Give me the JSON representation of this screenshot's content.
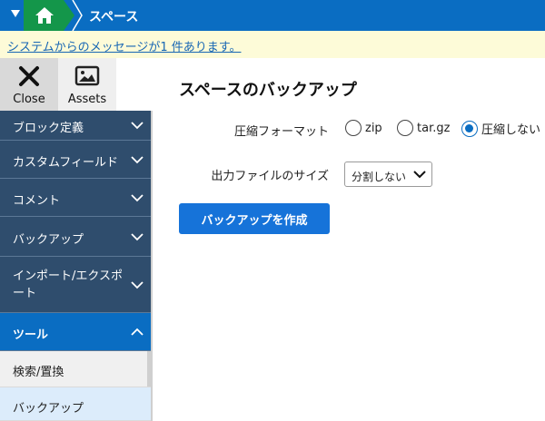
{
  "topbar": {
    "title": "スペース"
  },
  "message": {
    "text": "システムからのメッセージが1 件あります。"
  },
  "tools": {
    "close_label": "Close",
    "assets_label": "Assets"
  },
  "sidebar": {
    "items": [
      {
        "label": "ブロック定義"
      },
      {
        "label": "カスタムフィールド"
      },
      {
        "label": "コメント"
      },
      {
        "label": "バックアップ"
      },
      {
        "label": "インポート/エクスポート"
      },
      {
        "label": "ツール"
      }
    ],
    "sub_items": [
      {
        "label": "検索/置換"
      },
      {
        "label": "バックアップ"
      }
    ]
  },
  "main": {
    "title": "スペースのバックアップ",
    "compression_label": "圧縮フォーマット",
    "compression_options": [
      "zip",
      "tar.gz",
      "圧縮しない"
    ],
    "compression_selected": "圧縮しない",
    "size_label": "出力ファイルのサイズ",
    "size_value": "分割しない",
    "create_button": "バックアップを作成"
  },
  "colors": {
    "header_blue": "#0a6dc2",
    "home_green": "#14964a",
    "sidebar_dark": "#2f4d6d",
    "button_blue": "#1673d9"
  }
}
